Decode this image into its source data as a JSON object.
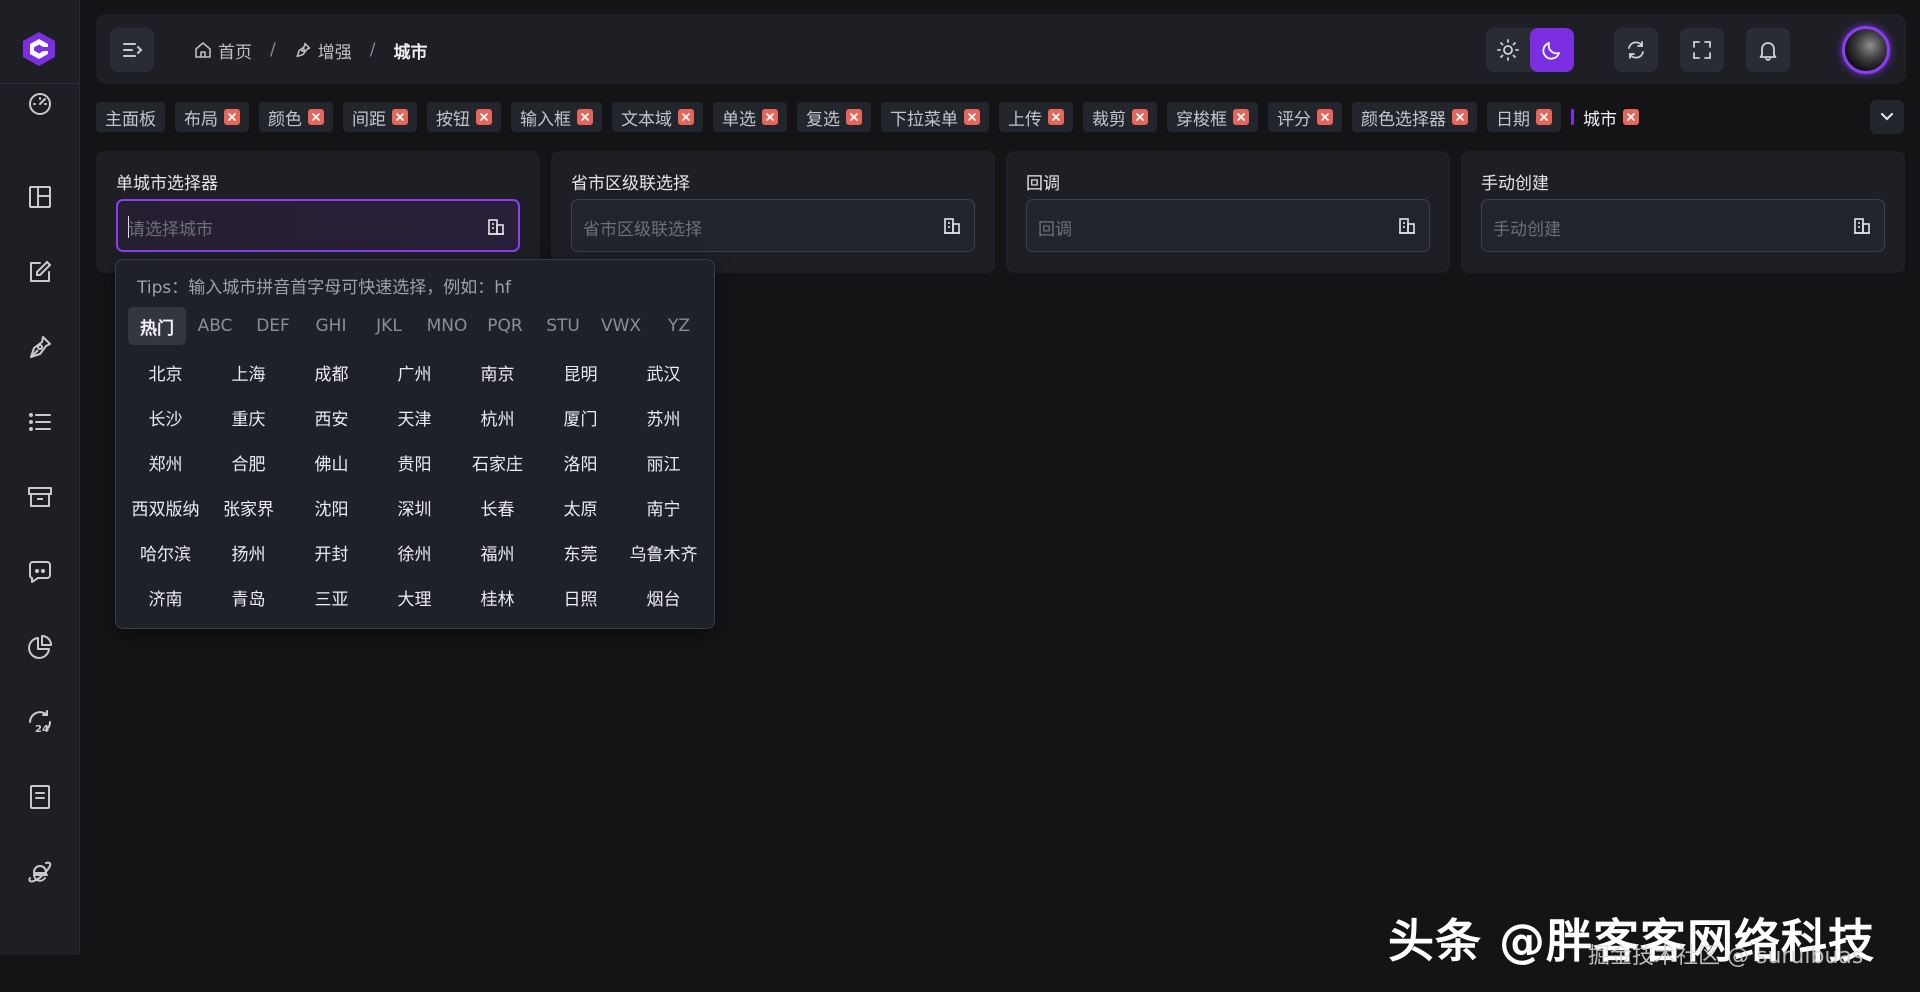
{
  "sidebar": {
    "items": [
      {
        "icon": "dashboard-icon"
      },
      {
        "icon": "layout-icon"
      },
      {
        "icon": "form-edit-icon"
      },
      {
        "icon": "pen-tool-icon"
      },
      {
        "icon": "list-icon"
      },
      {
        "icon": "archive-icon"
      },
      {
        "icon": "chat-icon"
      },
      {
        "icon": "pie-chart-icon"
      },
      {
        "icon": "24-hours-icon"
      },
      {
        "icon": "document-icon"
      },
      {
        "icon": "ie-browser-icon"
      }
    ]
  },
  "header": {
    "breadcrumbs": [
      {
        "label": "首页",
        "icon": "home-icon"
      },
      {
        "label": "增强",
        "icon": "pen-tool-icon"
      },
      {
        "label": "城市"
      }
    ],
    "separator": "/"
  },
  "tabs": [
    {
      "label": "主面板",
      "closable": false
    },
    {
      "label": "布局",
      "closable": true
    },
    {
      "label": "颜色",
      "closable": true
    },
    {
      "label": "间距",
      "closable": true
    },
    {
      "label": "按钮",
      "closable": true
    },
    {
      "label": "输入框",
      "closable": true
    },
    {
      "label": "文本域",
      "closable": true
    },
    {
      "label": "单选",
      "closable": true
    },
    {
      "label": "复选",
      "closable": true
    },
    {
      "label": "下拉菜单",
      "closable": true
    },
    {
      "label": "上传",
      "closable": true
    },
    {
      "label": "裁剪",
      "closable": true
    },
    {
      "label": "穿梭框",
      "closable": true
    },
    {
      "label": "评分",
      "closable": true
    },
    {
      "label": "颜色选择器",
      "closable": true
    },
    {
      "label": "日期",
      "closable": true
    },
    {
      "label": "城市",
      "closable": true,
      "active": true
    }
  ],
  "cards": [
    {
      "title": "单城市选择器",
      "placeholder": "请选择城市",
      "focused": true
    },
    {
      "title": "省市区级联选择",
      "placeholder": "省市区级联选择"
    },
    {
      "title": "回调",
      "placeholder": "回调"
    },
    {
      "title": "手动创建",
      "placeholder": "手动创建"
    }
  ],
  "city_picker": {
    "tips": "Tips：输入城市拼音首字母可快速选择，例如：hf",
    "letters": [
      "热门",
      "ABC",
      "DEF",
      "GHI",
      "JKL",
      "MNO",
      "PQR",
      "STU",
      "VWX",
      "YZ"
    ],
    "active_letter": "热门",
    "cities": [
      "北京",
      "上海",
      "成都",
      "广州",
      "南京",
      "昆明",
      "武汉",
      "长沙",
      "重庆",
      "西安",
      "天津",
      "杭州",
      "厦门",
      "苏州",
      "郑州",
      "合肥",
      "佛山",
      "贵阳",
      "石家庄",
      "洛阳",
      "丽江",
      "西双版纳",
      "张家界",
      "沈阳",
      "深圳",
      "长春",
      "太原",
      "南宁",
      "哈尔滨",
      "扬州",
      "开封",
      "徐州",
      "福州",
      "东莞",
      "乌鲁木齐",
      "济南",
      "青岛",
      "三亚",
      "大理",
      "桂林",
      "日照",
      "烟台"
    ]
  },
  "watermark": {
    "main": "头条 @胖客客网络科技",
    "sub": "掘金技术社区 @ suruibuas"
  },
  "colors": {
    "accent": "#7b2fe0",
    "close_badge": "#e7665a",
    "background": "#141417",
    "panel": "#1e1f25"
  }
}
